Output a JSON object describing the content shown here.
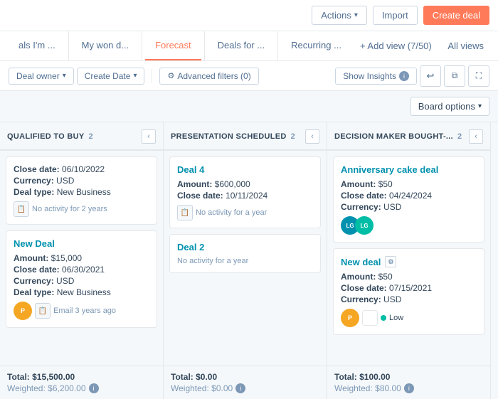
{
  "topbar": {
    "actions_label": "Actions",
    "import_label": "Import",
    "create_deal_label": "Create deal"
  },
  "tabs": {
    "items": [
      {
        "id": "als",
        "label": "als I'm ...",
        "active": false
      },
      {
        "id": "my-won",
        "label": "My won d...",
        "active": false
      },
      {
        "id": "forecast",
        "label": "Forecast",
        "active": true
      },
      {
        "id": "deals-for",
        "label": "Deals for ...",
        "active": false
      },
      {
        "id": "recurring",
        "label": "Recurring ...",
        "active": false
      }
    ],
    "add_view": "+ Add view (7/50)",
    "all_views": "All views"
  },
  "filters": {
    "deal_owner": "Deal owner",
    "create_date": "Create Date",
    "advanced_filters": "Advanced filters (0)",
    "show_insights": "Show Insights",
    "undo_label": "undo",
    "copy_label": "copy",
    "fullscreen_label": "fullscreen"
  },
  "board_options": {
    "label": "Board options"
  },
  "columns": [
    {
      "id": "qualified",
      "title": "QUALIFIED TO BUY",
      "count": 2,
      "cards": [
        {
          "id": "c1",
          "title": null,
          "fields": [
            {
              "label": "Close date:",
              "value": "06/10/2022"
            },
            {
              "label": "Currency:",
              "value": "USD"
            },
            {
              "label": "Deal type:",
              "value": "New Business"
            }
          ],
          "activity": "No activity for 2 years",
          "has_activity_icon": true,
          "avatar": null
        },
        {
          "id": "c2",
          "title": "New Deal",
          "fields": [
            {
              "label": "Amount:",
              "value": "$15,000"
            },
            {
              "label": "Close date:",
              "value": "06/30/2021"
            },
            {
              "label": "Currency:",
              "value": "USD"
            },
            {
              "label": "Deal type:",
              "value": "New Business"
            }
          ],
          "activity": "Email 3 years ago",
          "has_activity_icon": false,
          "avatar": "person"
        }
      ],
      "total": "Total: $15,500.00",
      "weighted": "Weighted: $6,200.00"
    },
    {
      "id": "presentation",
      "title": "PRESENTATION SCHEDULED",
      "count": 2,
      "cards": [
        {
          "id": "c3",
          "title": "Deal 4",
          "fields": [
            {
              "label": "Amount:",
              "value": "$600,000"
            },
            {
              "label": "Close date:",
              "value": "10/11/2024"
            }
          ],
          "activity": "No activity for a year",
          "has_activity_icon": true,
          "avatar": null
        },
        {
          "id": "c4",
          "title": "Deal 2",
          "fields": [],
          "activity": "No activity for a year",
          "has_activity_icon": false,
          "avatar": null
        }
      ],
      "total": "Total: $0.00",
      "weighted": "Weighted: $0.00"
    },
    {
      "id": "decision-maker",
      "title": "DECISION MAKER BOUGHT-...",
      "count": 2,
      "cards": [
        {
          "id": "c5",
          "title": "Anniversary cake deal",
          "fields": [
            {
              "label": "Amount:",
              "value": "$50"
            },
            {
              "label": "Close date:",
              "value": "04/24/2024"
            },
            {
              "label": "Currency:",
              "value": "USD"
            }
          ],
          "activity": null,
          "has_activity_icon": false,
          "avatar": "pair"
        },
        {
          "id": "c6",
          "title": "New deal",
          "fields": [
            {
              "label": "Amount:",
              "value": "$50"
            },
            {
              "label": "Close date:",
              "value": "07/15/2021"
            },
            {
              "label": "Currency:",
              "value": "USD"
            }
          ],
          "activity": "Low",
          "has_activity_icon": false,
          "avatar": "single2"
        }
      ],
      "total": "Total: $100.00",
      "weighted": "Weighted: $80.00"
    }
  ]
}
